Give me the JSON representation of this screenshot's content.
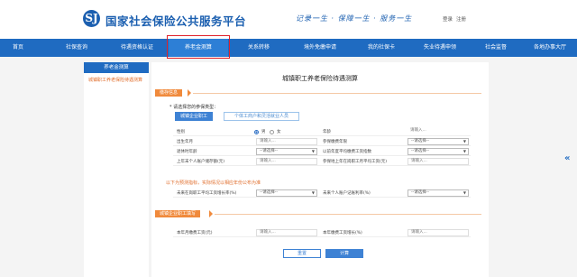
{
  "header": {
    "logo_glyph": "SJ",
    "title": "国家社会保险公共服务平台",
    "slogan": "记录一生 · 保障一生 · 服务一生",
    "login": "登录",
    "register": "注册"
  },
  "nav": {
    "items": [
      "首页",
      "社保查询",
      "待遇资格认证",
      "养老金测算",
      "关系转移",
      "境外免缴申请",
      "我的社保卡",
      "失业待遇申领",
      "社会监督",
      "各地办事大厅"
    ],
    "active": "养老金测算"
  },
  "sidebar": {
    "heading": "养老金测算",
    "items": [
      "城镇职工养老保险待遇测算"
    ]
  },
  "main": {
    "title": "城镇职工养老保险待遇测算",
    "section1": "缴存信息",
    "choose_label": "* 请选择您的参保类型：",
    "type_primary": "城镇企业职工",
    "type_secondary": "个体工商户和灵活就业人员",
    "fields": {
      "gender_label": "性别",
      "male": "男",
      "female": "女",
      "age_label": "年龄",
      "age_placeholder": "请输入...",
      "birth_label": "出生年月",
      "birth_placeholder": "请输入...",
      "work_age_label": "参保缴费年限",
      "select_placeholder": "--请选择--",
      "pension_label": "退休时年龄",
      "prev_wage_label": "以前年度平均缴费工资指数",
      "personal_balance_label": "上年末个人账户储存额(元)",
      "personal_balance_placeholder": "请输入...",
      "city_wage_label": "参保地上年在岗职工月平均工资(元)",
      "city_wage_placeholder": "请输入...",
      "future_wage_growth_label": "未来在岗职工平均工资增长率(%)",
      "future_account_rate_label": "未来个人账户记账利率(%)"
    },
    "warn": "以下为预测指标，实际情况以相应年份公布为准",
    "section2": "城镇企业职工填写",
    "current_wage_label": "本年月缴费工资(元)",
    "current_wage_placeholder": "请输入...",
    "planned_wage_label": "本年缴费工资增长(%)",
    "planned_wage_placeholder": "请输入...",
    "reset": "重置",
    "calc": "计算"
  }
}
